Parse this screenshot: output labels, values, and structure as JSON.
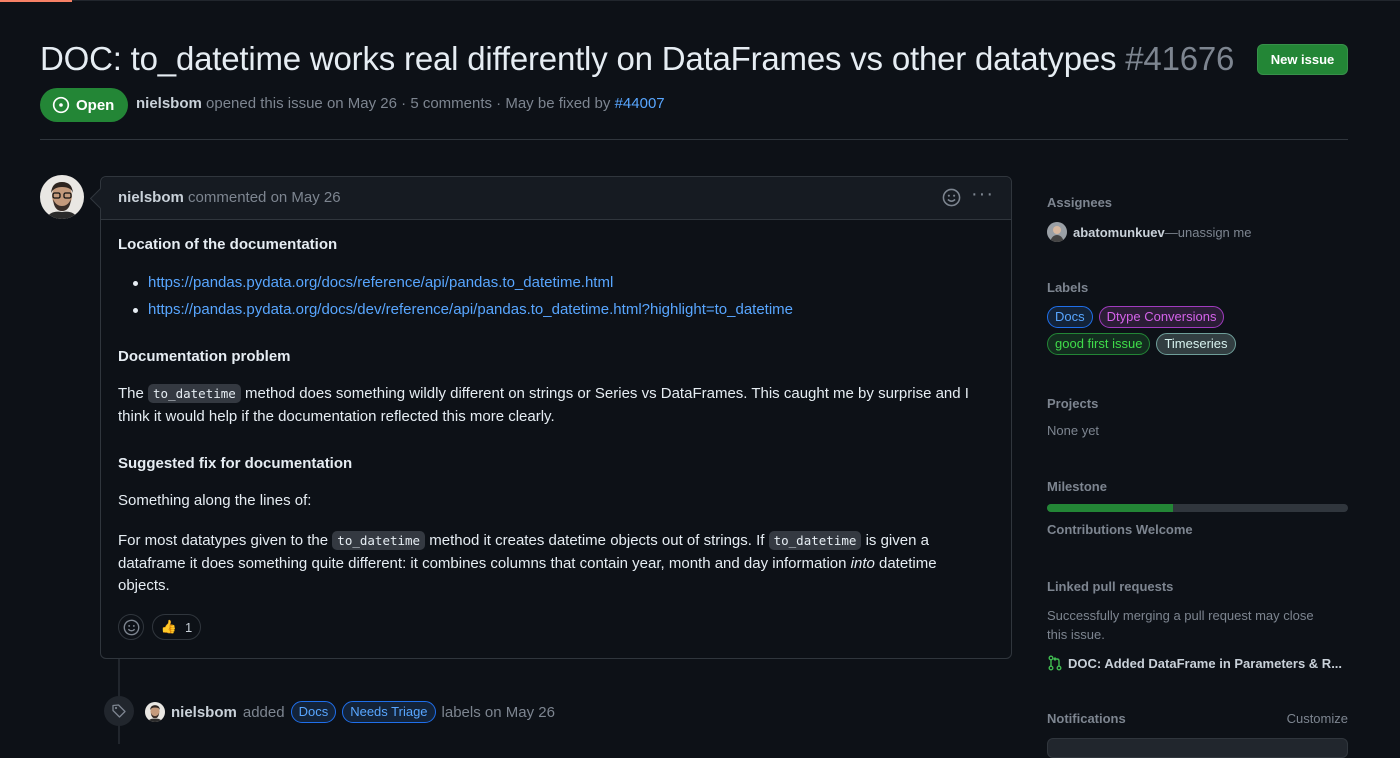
{
  "issue": {
    "title": "DOC: to_datetime works real differently on DataFrames vs other datatypes",
    "number": "#41676",
    "new_issue_label": "New issue",
    "state": "Open",
    "author": "nielsbom",
    "opened_text": "opened this issue on May 26 · 5 comments · May be fixed by",
    "fix_pr": "#44007"
  },
  "comment": {
    "author": "nielsbom",
    "when": "commented on May 26",
    "more_label": "···",
    "heading1": "Location of the documentation",
    "links": [
      "https://pandas.pydata.org/docs/reference/api/pandas.to_datetime.html",
      "https://pandas.pydata.org/docs/dev/reference/api/pandas.to_datetime.html?highlight=to_datetime"
    ],
    "heading2": "Documentation problem",
    "p1_a": "The",
    "code": "to_datetime",
    "p1_b": "method does something wildly different on strings or Series vs DataFrames. This caught me by surprise and I think it would help if the documentation reflected this more clearly.",
    "heading3": "Suggested fix for documentation",
    "p2": "Something along the lines of:",
    "p3_a": "For most datatypes given to the",
    "p3_b": "method it creates datetime objects out of strings. If",
    "p3_c": "is given a dataframe it does something quite different: it combines columns that contain year, month and day information",
    "p3_em": "into",
    "p3_d": "datetime objects.",
    "reaction_emoji": "👍",
    "reaction_count": "1"
  },
  "event": {
    "actor": "nielsbom",
    "action": "added",
    "labels": [
      "Docs",
      "Needs Triage"
    ],
    "suffix": "labels on May 26"
  },
  "sidebar": {
    "assignees_title": "Assignees",
    "assignee": "abatomunkuev",
    "unassign": "—unassign me",
    "labels_title": "Labels",
    "labels": [
      "Docs",
      "Dtype Conversions",
      "good first issue",
      "Timeseries"
    ],
    "projects_title": "Projects",
    "projects_value": "None yet",
    "milestone_title": "Milestone",
    "milestone_progress": 0.42,
    "milestone_name": "Contributions Welcome",
    "linked_title": "Linked pull requests",
    "linked_desc": "Successfully merging a pull request may close this issue.",
    "linked_pr": "DOC: Added DataFrame in Parameters & R...",
    "notifications_title": "Notifications",
    "customize": "Customize"
  },
  "colors": {
    "open": "#238636",
    "link": "#58a6ff",
    "label_docs": "#58a6ff",
    "label_dtype": "#d462e9",
    "label_good_first": "#2ea043",
    "label_timeseries": "#b7e0dc"
  }
}
